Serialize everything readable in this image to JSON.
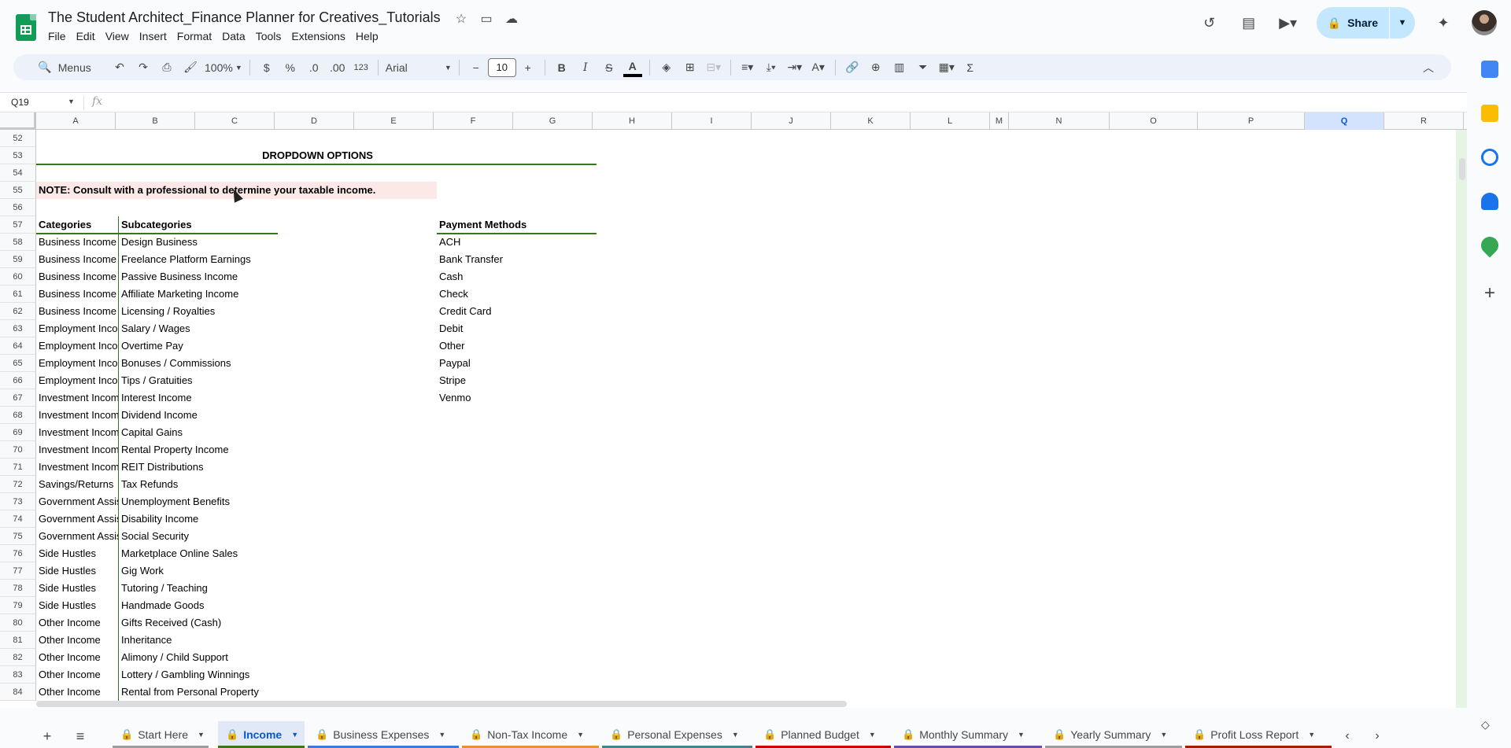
{
  "document": {
    "title": "The Student Architect_Finance Planner for Creatives_Tutorials"
  },
  "menus": [
    "File",
    "Edit",
    "View",
    "Insert",
    "Format",
    "Data",
    "Tools",
    "Extensions",
    "Help"
  ],
  "toolbar": {
    "search_label": "Menus",
    "zoom": "100%",
    "currency": "$",
    "percent": "%",
    "dec_decrease": ".0",
    "dec_increase": ".00",
    "number_format": "123",
    "font": "Arial",
    "font_size": "10",
    "bold": "B",
    "italic": "I",
    "strike": "S",
    "text_color": "A",
    "sum": "Σ"
  },
  "header": {
    "share_label": "Share"
  },
  "formula_bar": {
    "name_box": "Q19",
    "fx": "fx",
    "content": ""
  },
  "columns": [
    "A",
    "B",
    "C",
    "D",
    "E",
    "F",
    "G",
    "H",
    "I",
    "J",
    "K",
    "L",
    "M",
    "N",
    "O",
    "P",
    "Q",
    "R"
  ],
  "selected_column": "Q",
  "rows": [
    "52",
    "53",
    "54",
    "55",
    "56",
    "57",
    "58",
    "59",
    "60",
    "61",
    "62",
    "63",
    "64",
    "65",
    "66",
    "67",
    "68",
    "69",
    "70",
    "71",
    "72",
    "73",
    "74",
    "75",
    "76",
    "77",
    "78",
    "79",
    "80",
    "81",
    "82",
    "83",
    "84"
  ],
  "sheet": {
    "dropdown_title": "DROPDOWN OPTIONS",
    "note": "NOTE: Consult with a professional to determine your taxable income.",
    "categories_header": "Categories",
    "subcategories_header": "Subcategories",
    "payment_header": "Payment Methods",
    "categories": [
      "Business Income",
      "Business Income",
      "Business Income",
      "Business Income",
      "Business Income",
      "Employment Income",
      "Employment Income",
      "Employment Income",
      "Employment Income",
      "Investment Income",
      "Investment Income",
      "Investment Income",
      "Investment Income",
      "Investment Income",
      "Savings/Returns",
      "Government Assistance",
      "Government Assistance",
      "Government Assistance",
      "Side Hustles",
      "Side Hustles",
      "Side Hustles",
      "Side Hustles",
      "Other Income",
      "Other Income",
      "Other Income",
      "Other Income",
      "Other Income"
    ],
    "subcategories": [
      "Design Business",
      "Freelance Platform Earnings",
      "Passive Business Income",
      "Affiliate Marketing Income",
      "Licensing / Royalties",
      "Salary / Wages",
      "Overtime Pay",
      "Bonuses / Commissions",
      "Tips / Gratuities",
      "Interest Income",
      "Dividend Income",
      "Capital Gains",
      "Rental Property Income",
      "REIT Distributions",
      "Tax Refunds",
      "Unemployment Benefits",
      "Disability Income",
      "Social Security",
      "Marketplace Online Sales",
      "Gig Work",
      "Tutoring / Teaching",
      "Handmade Goods",
      "Gifts Received (Cash)",
      "Inheritance",
      "Alimony / Child Support",
      "Lottery / Gambling Winnings",
      "Rental from Personal Property"
    ],
    "payment_methods": [
      "ACH",
      "Bank Transfer",
      "Cash",
      "Check",
      "Credit Card",
      "Debit",
      "Other",
      "Paypal",
      "Stripe",
      "Venmo"
    ]
  },
  "tabs": [
    {
      "label": "Start Here",
      "color": "#9e9e9e",
      "active": false
    },
    {
      "label": "Income",
      "color": "#38761d",
      "active": true
    },
    {
      "label": "Business Expenses",
      "color": "#3c78d8",
      "active": false
    },
    {
      "label": "Non-Tax Income",
      "color": "#e69138",
      "active": false
    },
    {
      "label": "Personal Expenses",
      "color": "#45818e",
      "active": false
    },
    {
      "label": "Planned Budget",
      "color": "#cc0000",
      "active": false
    },
    {
      "label": "Monthly Summary",
      "color": "#674ea7",
      "active": false
    },
    {
      "label": "Yearly Summary",
      "color": "#9e9e9e",
      "active": false
    },
    {
      "label": "Profit Loss Report",
      "color": "#a61c00",
      "active": false
    }
  ],
  "colors": {
    "accent_green": "#38761d",
    "note_background": "#fce8e6",
    "share_background": "#c2e7ff",
    "active_tab": "#0b57d0"
  }
}
